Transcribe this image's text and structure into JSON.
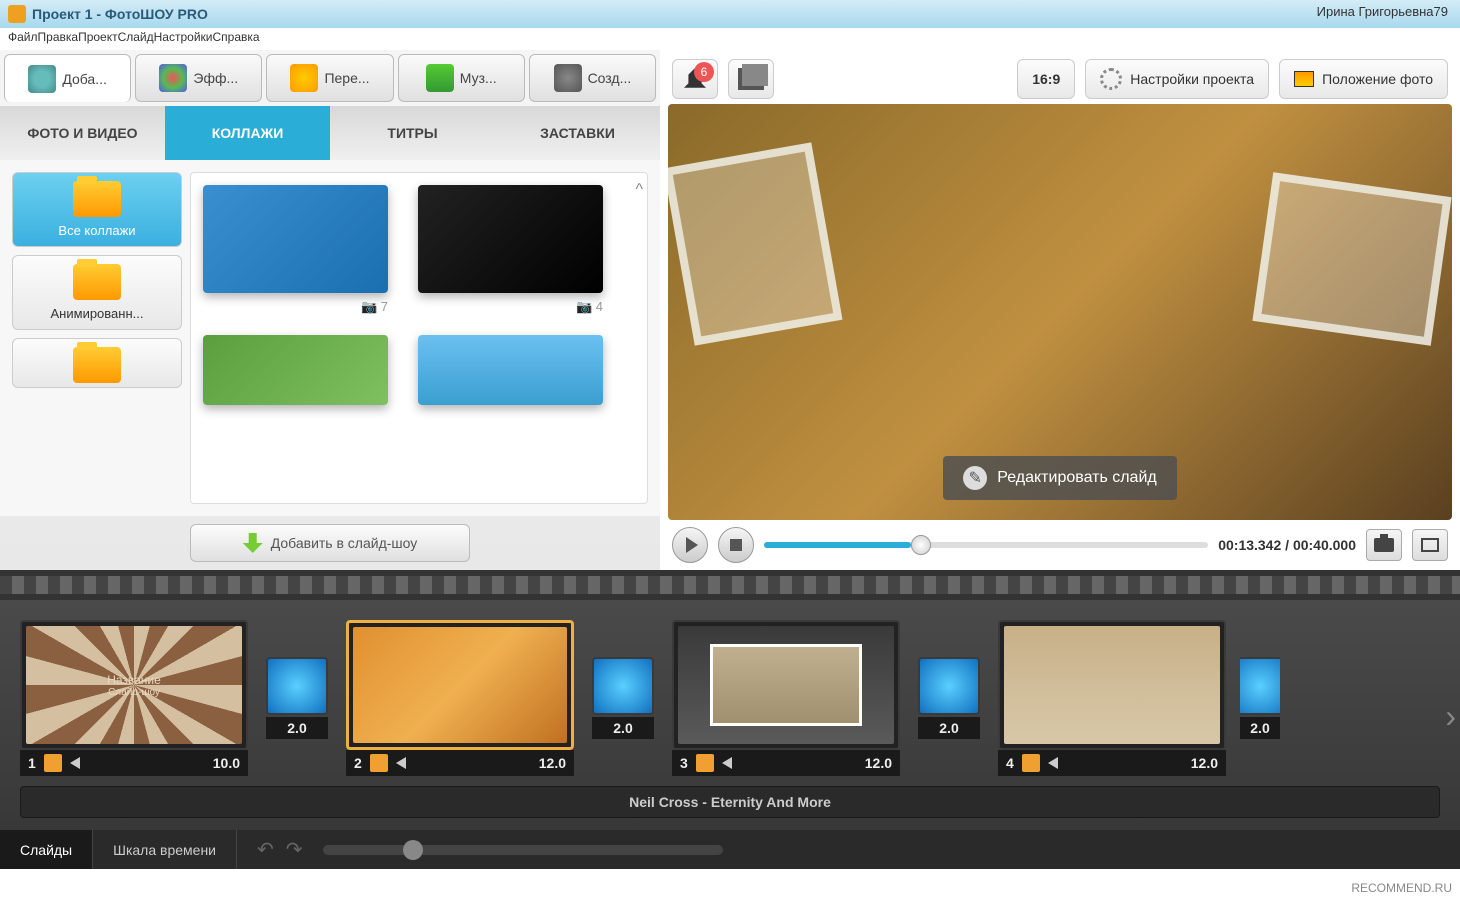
{
  "window": {
    "title": "Проект 1 - ФотоШОУ PRO",
    "user": "Ирина Григорьевна79"
  },
  "menu": {
    "file": "Файл",
    "edit": "Правка",
    "project": "Проект",
    "slide": "Слайд",
    "settings": "Настройки",
    "help": "Справка"
  },
  "tool_tabs": {
    "add": "Доба...",
    "effects": "Эфф...",
    "transitions": "Пере...",
    "music": "Муз...",
    "create": "Созд..."
  },
  "sub_tabs": {
    "photo_video": "ФОТО И ВИДЕО",
    "collages": "КОЛЛАЖИ",
    "titles": "ТИТРЫ",
    "intros": "ЗАСТАВКИ"
  },
  "categories": {
    "all": "Все коллажи",
    "animated": "Анимированн..."
  },
  "templates": {
    "count_1": "7",
    "count_2": "4"
  },
  "add_button": "Добавить в слайд-шоу",
  "right_toolbar": {
    "notifications": "6",
    "aspect": "16:9",
    "project_settings": "Настройки проекта",
    "photo_position": "Положение фото"
  },
  "preview": {
    "edit_slide": "Редактировать слайд"
  },
  "playback": {
    "current": "00:13.342",
    "sep": " / ",
    "total": "00:40.000"
  },
  "slides": [
    {
      "num": "1",
      "duration": "10.0"
    },
    {
      "num": "2",
      "duration": "12.0"
    },
    {
      "num": "3",
      "duration": "12.0"
    },
    {
      "num": "4",
      "duration": "12.0"
    }
  ],
  "transitions": [
    {
      "duration": "2.0"
    },
    {
      "duration": "2.0"
    },
    {
      "duration": "2.0"
    },
    {
      "duration": "2.0"
    }
  ],
  "slide1_text": {
    "line1": "Название",
    "line2": "Слайд-шоу"
  },
  "audio_track": "Neil Cross - Eternity And More",
  "bottom": {
    "slides": "Слайды",
    "timeline": "Шкала времени"
  },
  "watermark": "RECOMMEND.RU"
}
